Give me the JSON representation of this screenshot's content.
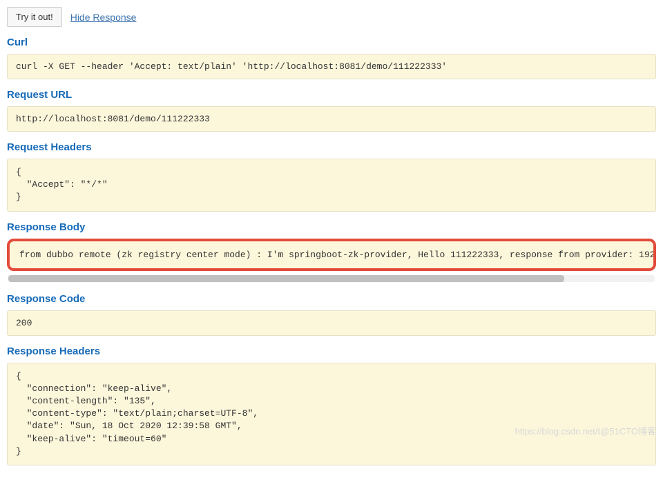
{
  "top": {
    "try_button": "Try it out!",
    "hide_link": "Hide Response"
  },
  "sections": {
    "curl": {
      "title": "Curl",
      "content": "curl -X GET --header 'Accept: text/plain' 'http://localhost:8081/demo/111222333'"
    },
    "request_url": {
      "title": "Request URL",
      "content": "http://localhost:8081/demo/111222333"
    },
    "request_headers": {
      "title": "Request Headers",
      "content": "{\n  \"Accept\": \"*/*\"\n}"
    },
    "response_body": {
      "title": "Response Body",
      "content": "from dubbo remote (zk registry center mode) : I'm springboot-zk-provider, Hello 111222333, response from provider: 192"
    },
    "response_code": {
      "title": "Response Code",
      "content": "200"
    },
    "response_headers": {
      "title": "Response Headers",
      "content": "{\n  \"connection\": \"keep-alive\",\n  \"content-length\": \"135\",\n  \"content-type\": \"text/plain;charset=UTF-8\",\n  \"date\": \"Sun, 18 Oct 2020 12:39:58 GMT\",\n  \"keep-alive\": \"timeout=60\"\n}"
    }
  },
  "watermark": "https://blog.csdn.net/t@51CTO博客"
}
